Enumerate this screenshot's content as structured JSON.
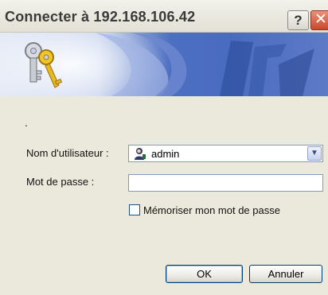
{
  "window": {
    "title": "Connecter à 192.168.106.42",
    "help_label": "?",
    "close_label": "✕"
  },
  "banner": {
    "icon": "keys-icon"
  },
  "form": {
    "status_text": ".",
    "username_label": "Nom d'utilisateur :",
    "username_value": "admin",
    "password_label": "Mot de passe :",
    "password_value": "",
    "remember_label": "Mémoriser mon mot de passe",
    "remember_checked": false
  },
  "buttons": {
    "ok_label": "OK",
    "cancel_label": "Annuler"
  }
}
